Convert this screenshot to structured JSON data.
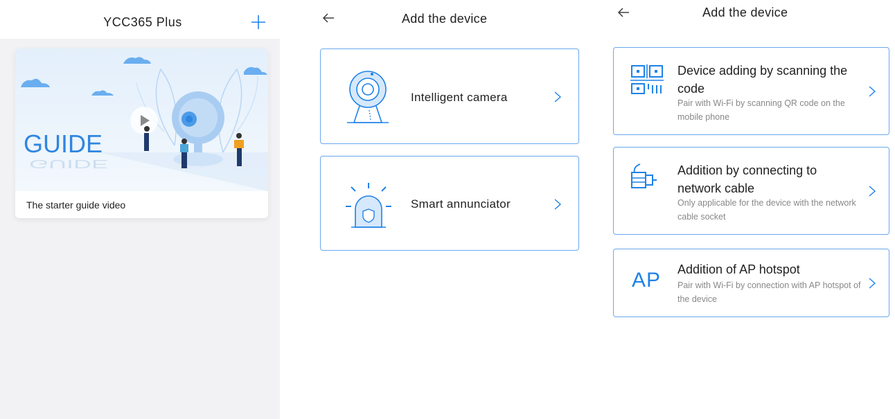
{
  "home": {
    "title": "YCC365 Plus",
    "guide": {
      "image_text": "GUIDE",
      "caption": "The starter guide video"
    }
  },
  "device_type": {
    "title": "Add the device",
    "items": [
      {
        "label": "Intelligent camera",
        "icon": "camera-icon"
      },
      {
        "label": "Smart annunciator",
        "icon": "alarm-icon"
      }
    ]
  },
  "add_method": {
    "title": "Add the device",
    "options": [
      {
        "title": "Device adding by scanning the code",
        "subtitle": "Pair with Wi-Fi by scanning QR code on the mobile phone",
        "icon": "qr-code-icon"
      },
      {
        "title": "Addition by connecting to network cable",
        "subtitle": "Only applicable for the device with the network cable socket",
        "icon": "network-cable-icon"
      },
      {
        "title": "Addition of AP hotspot",
        "subtitle": "Pair with Wi-Fi by connection with AP hotspot of the device",
        "icon_text": "AP"
      }
    ]
  },
  "colors": {
    "accent": "#1e82e8",
    "border": "#6aa8ee",
    "background": "#f2f2f4"
  }
}
